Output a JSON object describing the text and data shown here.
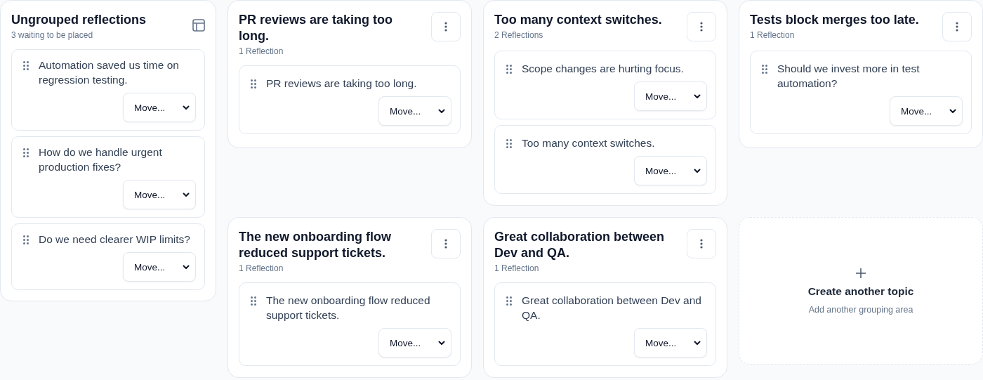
{
  "ungrouped": {
    "title": "Ungrouped reflections",
    "subtitle": "3 waiting to be placed",
    "reflections": [
      {
        "text": "Automation saved us time on regression testing.",
        "move_label": "Move..."
      },
      {
        "text": "How do we handle urgent production fixes?",
        "move_label": "Move..."
      },
      {
        "text": "Do we need clearer WIP limits?",
        "move_label": "Move..."
      }
    ]
  },
  "topics": [
    {
      "title": "PR reviews are taking too long.",
      "count": "1 Reflection",
      "reflections": [
        {
          "text": "PR reviews are taking too long.",
          "move_label": "Move..."
        }
      ]
    },
    {
      "title": "Too many context switches.",
      "count": "2 Reflections",
      "reflections": [
        {
          "text": "Scope changes are hurting focus.",
          "move_label": "Move..."
        },
        {
          "text": "Too many context switches.",
          "move_label": "Move..."
        }
      ]
    },
    {
      "title": "Tests block merges too late.",
      "count": "1 Reflection",
      "reflections": [
        {
          "text": "Should we invest more in test automation?",
          "move_label": "Move..."
        }
      ]
    },
    {
      "title": "The new onboarding flow reduced support tickets.",
      "count": "1 Reflection",
      "reflections": [
        {
          "text": "The new onboarding flow reduced support tickets.",
          "move_label": "Move..."
        }
      ]
    },
    {
      "title": "Great collaboration between Dev and QA.",
      "count": "1 Reflection",
      "reflections": [
        {
          "text": "Great collaboration between Dev and QA.",
          "move_label": "Move..."
        }
      ]
    }
  ],
  "create_topic": {
    "title": "Create another topic",
    "subtitle": "Add another grouping area"
  }
}
